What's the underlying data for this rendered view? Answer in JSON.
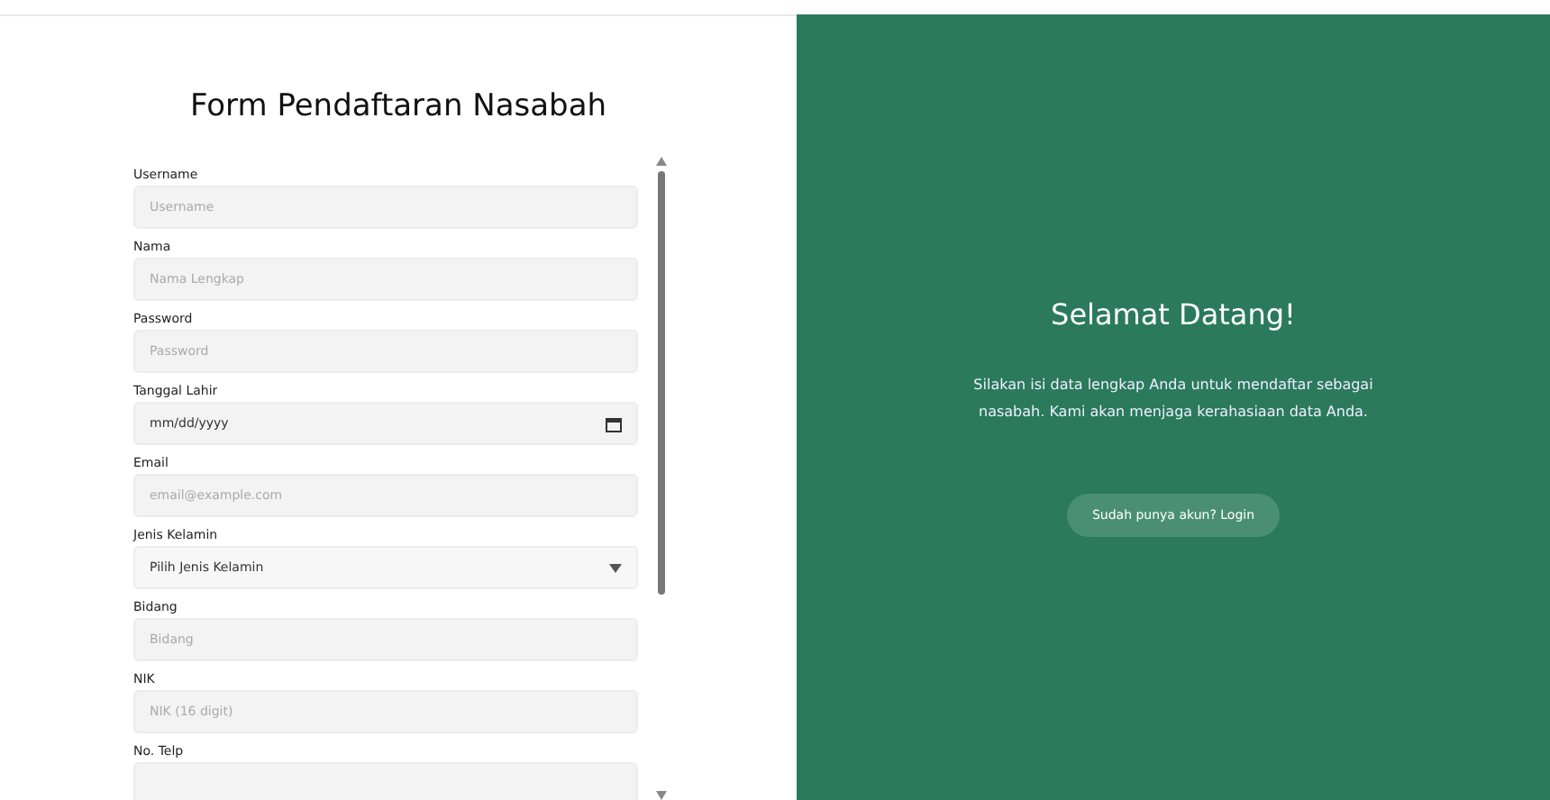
{
  "form": {
    "title": "Form Pendaftaran Nasabah",
    "fields": [
      {
        "label": "Username",
        "kind": "text",
        "placeholder": "Username"
      },
      {
        "label": "Nama",
        "kind": "text",
        "placeholder": "Nama Lengkap"
      },
      {
        "label": "Password",
        "kind": "text",
        "placeholder": "Password"
      },
      {
        "label": "Tanggal Lahir",
        "kind": "date",
        "value": "mm/dd/yyyy"
      },
      {
        "label": "Email",
        "kind": "text",
        "placeholder": "email@example.com"
      },
      {
        "label": "Jenis Kelamin",
        "kind": "select",
        "value": "Pilih Jenis Kelamin"
      },
      {
        "label": "Bidang",
        "kind": "text",
        "placeholder": "Bidang"
      },
      {
        "label": "NIK",
        "kind": "text",
        "placeholder": "NIK (16 digit)"
      },
      {
        "label": "No. Telp",
        "kind": "text"
      }
    ]
  },
  "welcome": {
    "title": "Selamat Datang!",
    "text": "Silakan isi data lengkap Anda untuk mendaftar sebagai nasabah. Kami akan menjaga kerahasiaan data Anda.",
    "button": "Sudah punya akun? Login"
  }
}
